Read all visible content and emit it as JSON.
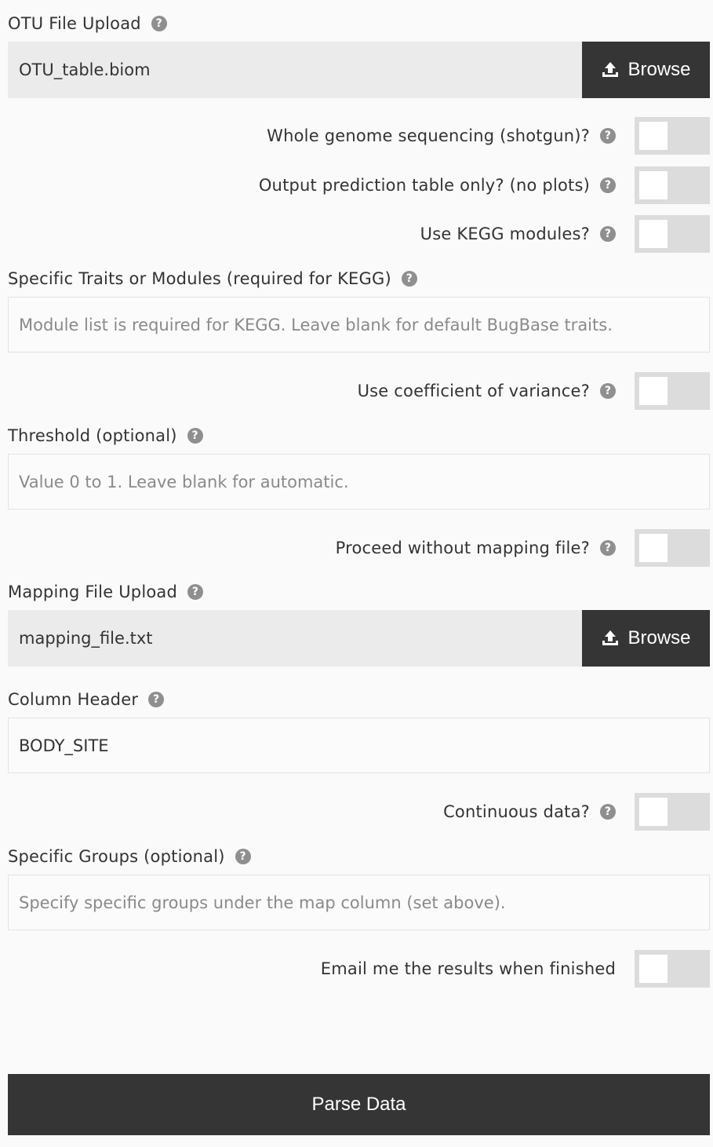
{
  "otu_upload": {
    "label": "OTU File Upload",
    "file_name": "OTU_table.biom",
    "browse_label": "Browse"
  },
  "toggles": {
    "wgs": {
      "label": "Whole genome sequencing (shotgun)?",
      "on": false
    },
    "prediction_only": {
      "label": "Output prediction table only? (no plots)",
      "on": false
    },
    "kegg": {
      "label": "Use KEGG modules?",
      "on": false
    },
    "cov": {
      "label": "Use coefficient of variance?",
      "on": false
    },
    "no_mapping": {
      "label": "Proceed without mapping file?",
      "on": false
    },
    "continuous": {
      "label": "Continuous data?",
      "on": false
    },
    "email": {
      "label": "Email me the results when finished",
      "on": false
    }
  },
  "traits": {
    "label": "Specific Traits or Modules (required for KEGG)",
    "placeholder": "Module list is required for KEGG. Leave blank for default BugBase traits."
  },
  "threshold": {
    "label": "Threshold (optional)",
    "placeholder": "Value 0 to 1. Leave blank for automatic."
  },
  "mapping_upload": {
    "label": "Mapping File Upload",
    "file_name": "mapping_file.txt",
    "browse_label": "Browse"
  },
  "column_header": {
    "label": "Column Header",
    "value": "BODY_SITE"
  },
  "groups": {
    "label": "Specific Groups (optional)",
    "placeholder": "Specify specific groups under the map column (set above)."
  },
  "help_glyph": "?",
  "submit_label": "Parse Data"
}
